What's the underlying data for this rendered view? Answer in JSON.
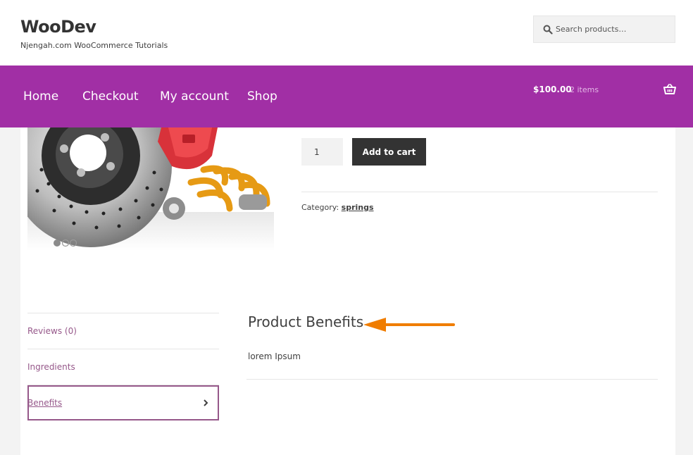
{
  "site": {
    "title": "WooDev",
    "tagline": "Njengah.com WooCommerce Tutorials"
  },
  "search": {
    "placeholder": "Search products…"
  },
  "nav": {
    "items": [
      {
        "label": "Home"
      },
      {
        "label": "Checkout"
      },
      {
        "label": "My account"
      },
      {
        "label": "Shop"
      }
    ]
  },
  "cart": {
    "total": "$100.00",
    "count": "2 items"
  },
  "product": {
    "quantity": "1",
    "add_to_cart": "Add to cart",
    "category_label": "Category:",
    "category_value": "springs"
  },
  "tabs": {
    "items": [
      {
        "label": "Reviews (0)"
      },
      {
        "label": "Ingredients"
      },
      {
        "label": "Benefits"
      }
    ]
  },
  "panel": {
    "title": "Product Benefits",
    "text": "lorem Ipsum"
  },
  "colors": {
    "brand": "#a12fa5",
    "tab_link": "#96588a",
    "button_dark": "#333333",
    "arrow": "#f07d00"
  }
}
